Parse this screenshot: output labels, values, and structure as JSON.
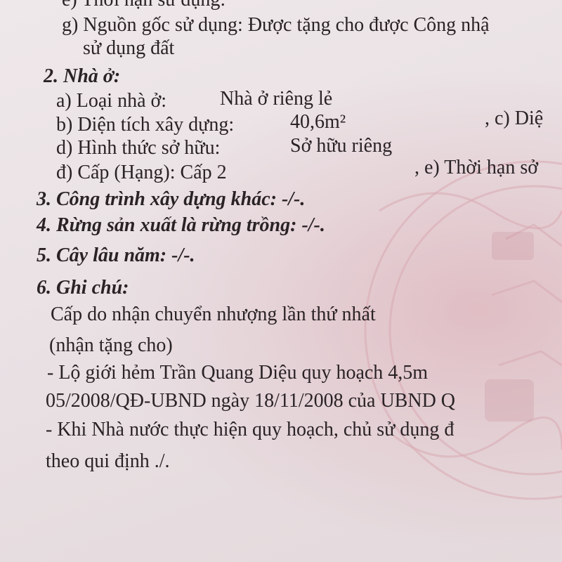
{
  "land": {
    "item_e_cut": "e) Thời hạn sử dụng:",
    "item_g": "g) Nguồn gốc sử dụng:  Được tặng cho được Công nhậ",
    "item_g_cont": "sử dụng đất"
  },
  "house": {
    "heading": "2. Nhà ở:",
    "type_label": "a) Loại nhà ở:",
    "type_value": "Nhà ở riêng lẻ",
    "area_label": "b) Diện tích xây dựng:",
    "area_value": "40,6m²",
    "area_side": ", c) Diệ",
    "ownership_label": "d) Hình thức sở hữu:",
    "ownership_value": "Sở hữu riêng",
    "grade_label": "đ) Cấp (Hạng):  Cấp 2",
    "grade_side": ", e) Thời hạn sở"
  },
  "other_construction": "3. Công trình xây dựng khác: -/-.",
  "production_forest": "4. Rừng sản xuất là rừng trồng: -/-.",
  "perennial_trees": "5. Cây lâu năm:  -/-.",
  "notes": {
    "heading": "6. Ghi chú:",
    "lines": [
      "Cấp do nhận chuyển nhượng lần thứ nhất",
      "(nhận tặng cho)",
      "- Lộ giới hẻm       Trần Quang Diệu quy hoạch 4,5m",
      "05/2008/QĐ-UBND ngày 18/11/2008 của UBND Q",
      "- Khi Nhà nước thực hiện quy hoạch, chủ sử dụng đ",
      "theo qui định ./."
    ]
  }
}
